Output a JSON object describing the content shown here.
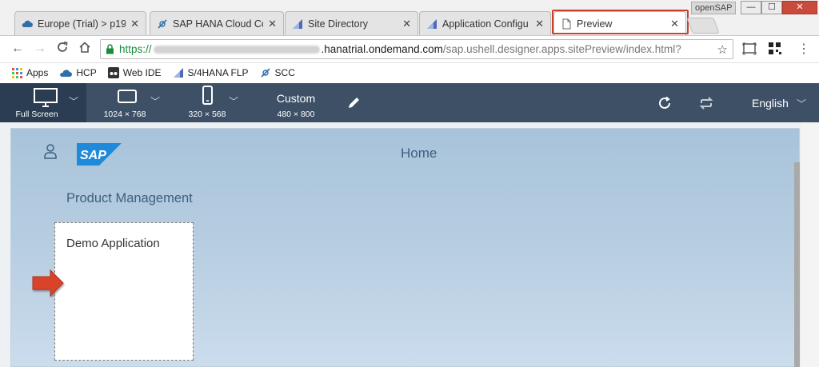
{
  "browser": {
    "profile": "openSAP",
    "window_controls": {
      "minimize": "—",
      "maximize": "☐",
      "close": "✕"
    },
    "tabs": [
      {
        "title": "Europe (Trial) > p19",
        "icon": "cloud-icon",
        "close": "✕"
      },
      {
        "title": "SAP HANA Cloud Co",
        "icon": "satellite-icon",
        "close": "✕"
      },
      {
        "title": "Site Directory",
        "icon": "site-icon",
        "close": "✕"
      },
      {
        "title": "Application Configu",
        "icon": "site-icon",
        "close": "✕"
      },
      {
        "title": "Preview",
        "icon": "page-icon",
        "close": "✕",
        "active": true
      }
    ],
    "nav": {
      "back": "←",
      "forward": "→",
      "reload": "C",
      "home": "⌂"
    },
    "url": {
      "scheme": "https://",
      "host": ".hanatrial.ondemand.com",
      "path": "/sap.ushell.designer.apps.sitePreview/index.html?"
    },
    "bookmarks": [
      {
        "label": "Apps",
        "icon": "apps-grid-icon"
      },
      {
        "label": "HCP",
        "icon": "cloud-icon"
      },
      {
        "label": "Web IDE",
        "icon": "webide-icon"
      },
      {
        "label": "S/4HANA FLP",
        "icon": "site-icon"
      },
      {
        "label": "SCC",
        "icon": "satellite-icon"
      }
    ]
  },
  "preview_toolbar": {
    "devices": [
      {
        "label": "Full Screen",
        "icon": "monitor-icon",
        "selected": true
      },
      {
        "label": "1024 × 768",
        "icon": "tablet-icon"
      },
      {
        "label": "320 × 568",
        "icon": "phone-icon"
      },
      {
        "label": "480 × 800",
        "title": "Custom"
      }
    ],
    "language": "English"
  },
  "launchpad": {
    "title": "Home",
    "logo": "SAP",
    "group": "Product Management",
    "tile": {
      "title": "Demo Application"
    }
  },
  "colors": {
    "toolbar_bg": "#3d5066",
    "highlight": "#c9412c",
    "arrow": "#d9432a",
    "sap_blue": "#1f8ad9"
  }
}
